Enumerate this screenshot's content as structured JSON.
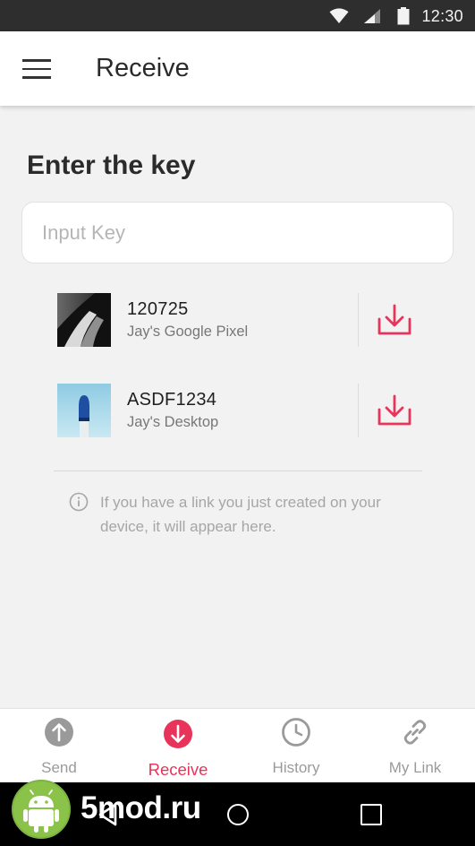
{
  "status_bar": {
    "time": "12:30",
    "icons": [
      "wifi-icon",
      "signal-icon",
      "battery-icon"
    ]
  },
  "app_bar": {
    "title": "Receive",
    "menu_icon": "hamburger-menu-icon"
  },
  "main": {
    "heading": "Enter the key",
    "key_input": {
      "placeholder": "Input Key",
      "value": ""
    },
    "items": [
      {
        "key": "120725",
        "device": "Jay's Google Pixel",
        "action_icon": "download-icon"
      },
      {
        "key": "ASDF1234",
        "device": "Jay's Desktop",
        "action_icon": "download-icon"
      }
    ],
    "info_icon": "info-icon",
    "info_text": "If you have a link you just created on your device, it will appear here."
  },
  "bottom_nav": {
    "active": "Receive",
    "items": [
      {
        "label": "Send",
        "icon": "arrow-up-icon"
      },
      {
        "label": "Receive",
        "icon": "arrow-down-icon"
      },
      {
        "label": "History",
        "icon": "clock-icon"
      },
      {
        "label": "My Link",
        "icon": "link-icon"
      }
    ]
  },
  "system_nav": {
    "buttons": [
      "back-icon",
      "home-icon",
      "recent-apps-icon"
    ]
  },
  "watermark": {
    "text": "5mod.ru",
    "logo": "android-robot-logo"
  },
  "colors": {
    "accent": "#e8335a",
    "inactive_nav": "#9a9a9a",
    "background": "#f2f2f2",
    "status_bar": "#2e2e2e",
    "watermark_green": "#8bc34a"
  }
}
